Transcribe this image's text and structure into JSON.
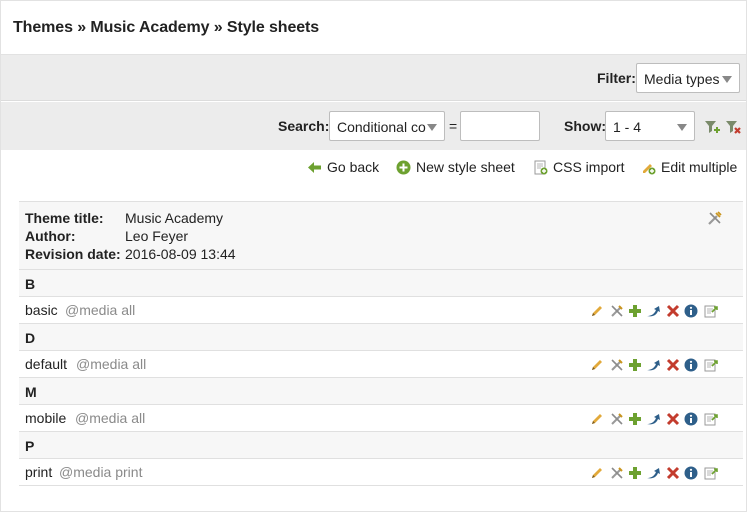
{
  "breadcrumb": "Themes » Music Academy » Style sheets",
  "filter": {
    "label": "Filter:",
    "value": "Media types"
  },
  "search": {
    "label": "Search:",
    "field_value": "Conditional co",
    "equals": "=",
    "query_value": ""
  },
  "show": {
    "label": "Show:",
    "value": "1 - 4"
  },
  "actions": {
    "go_back": "Go back",
    "new_style_sheet": "New style sheet",
    "css_import": "CSS import",
    "edit_multiple": "Edit multiple"
  },
  "theme": {
    "title_label": "Theme title:",
    "title": "Music Academy",
    "author_label": "Author:",
    "author": "Leo Feyer",
    "revision_label": "Revision date:",
    "revision": "2016-08-09 13:44"
  },
  "groups": [
    {
      "letter": "B",
      "name": "basic",
      "media": "@media all"
    },
    {
      "letter": "D",
      "name": "default",
      "media": "@media all"
    },
    {
      "letter": "M",
      "name": "mobile",
      "media": "@media all"
    },
    {
      "letter": "P",
      "name": "print",
      "media": "@media print"
    }
  ],
  "colors": {
    "toolbar_bg": "#ececec",
    "green_icon": "#6da130",
    "red_icon": "#c33c2e",
    "blue_icon": "#2e5f8a",
    "muted_text": "#8a8a8a"
  },
  "row_icon_names": [
    "edit-icon",
    "settings-icon",
    "copy-icon",
    "move-icon",
    "delete-icon",
    "info-icon",
    "export-icon"
  ]
}
